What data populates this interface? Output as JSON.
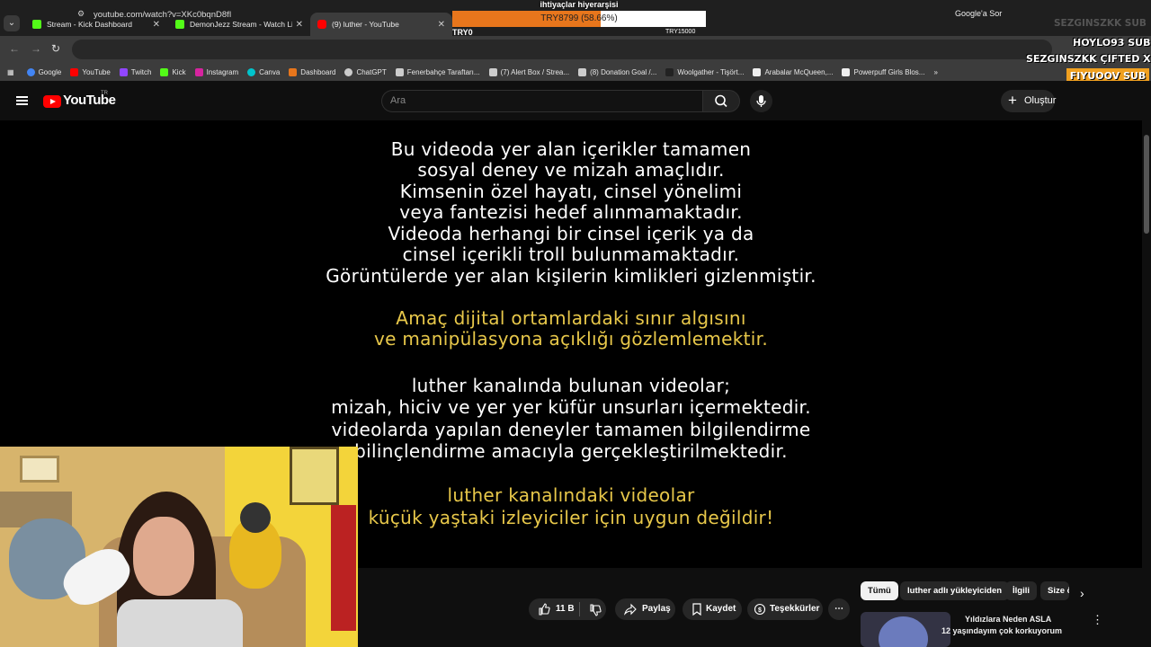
{
  "tabs": [
    {
      "title": "Stream - Kick Dashboard",
      "icon": "kick-icon"
    },
    {
      "title": "DemonJezz Stream - Watch Live",
      "icon": "kick-icon"
    },
    {
      "title": "(9) luther - YouTube",
      "icon": "youtube-icon"
    }
  ],
  "goal": {
    "title": "ihtiyaçlar hiyerarşisi",
    "text": "TRY8799 (58.66%)",
    "percent": 58.66,
    "min": "TRY0",
    "max": "TRY15000"
  },
  "browser": {
    "url": "youtube.com/watch?v=XKc0bqnD8fI",
    "google_sor": "Google'a Sor"
  },
  "bookmarks": [
    "Google",
    "YouTube",
    "Twitch",
    "Kick",
    "Instagram",
    "Canva",
    "Dashboard",
    "ChatGPT",
    "Fenerbahçe Taraftarı...",
    "(7) Alert Box / Strea...",
    "(8) Donation Goal /...",
    "Woolgather - Tişört...",
    "Arabalar McQueen,...",
    "Powerpuff Girls Blos..."
  ],
  "overlay": {
    "line1": "SEZGINSZKK SUB",
    "line2": "HOYLO93 SUB",
    "line3": "SEZGINSZKK ÇIFTED X1",
    "line4": "FIYUOOV SUB"
  },
  "youtube": {
    "logo_text": "YouTube",
    "country": "TR",
    "search_placeholder": "Ara",
    "create_label": "Oluştur"
  },
  "video_lines": [
    {
      "text": "Bu videoda yer alan içerikler tamamen",
      "color": "white"
    },
    {
      "text": "sosyal deney ve mizah amaçlıdır.",
      "color": "white"
    },
    {
      "text": "Kimsenin özel hayatı, cinsel yönelimi",
      "color": "white"
    },
    {
      "text": "veya fantezisi hedef alınmamaktadır.",
      "color": "white"
    },
    {
      "text": "Videoda herhangi bir cinsel içerik ya da",
      "color": "white"
    },
    {
      "text": "cinsel içerikli troll bulunmamaktadır.",
      "color": "white"
    },
    {
      "text": "Görüntülerde yer alan kişilerin kimlikleri gizlenmiştir.",
      "color": "white"
    },
    {
      "text": "Amaç dijital ortamlardaki sınır algısını",
      "color": "gold"
    },
    {
      "text": "ve manipülasyona açıklığı gözlemlemektir.",
      "color": "gold"
    },
    {
      "text": "luther kanalında bulunan videolar;",
      "color": "white"
    },
    {
      "text": "mizah, hiciv ve yer yer küfür unsurları içermektedir.",
      "color": "white"
    },
    {
      "text": "videolarda yapılan deneyler tamamen bilgilendirme",
      "color": "white"
    },
    {
      "text": "bilinçlendirme amacıyla gerçekleştirilmektedir.",
      "color": "white"
    },
    {
      "text": "luther kanalındaki videolar",
      "color": "gold"
    },
    {
      "text": "küçük yaştaki izleyiciler için uygun değildir!",
      "color": "gold"
    }
  ],
  "actions": {
    "likes": "11 B",
    "share": "Paylaş",
    "save": "Kaydet",
    "thanks": "Teşekkürler"
  },
  "chips": [
    "Tümü",
    "luther adlı yükleyiciden",
    "İlgili",
    "Size ö"
  ],
  "recommendation": {
    "title_line1": "Yıldızlara Neden ASLA",
    "title_line2": "12 yaşındayım çok korkuyorum"
  }
}
